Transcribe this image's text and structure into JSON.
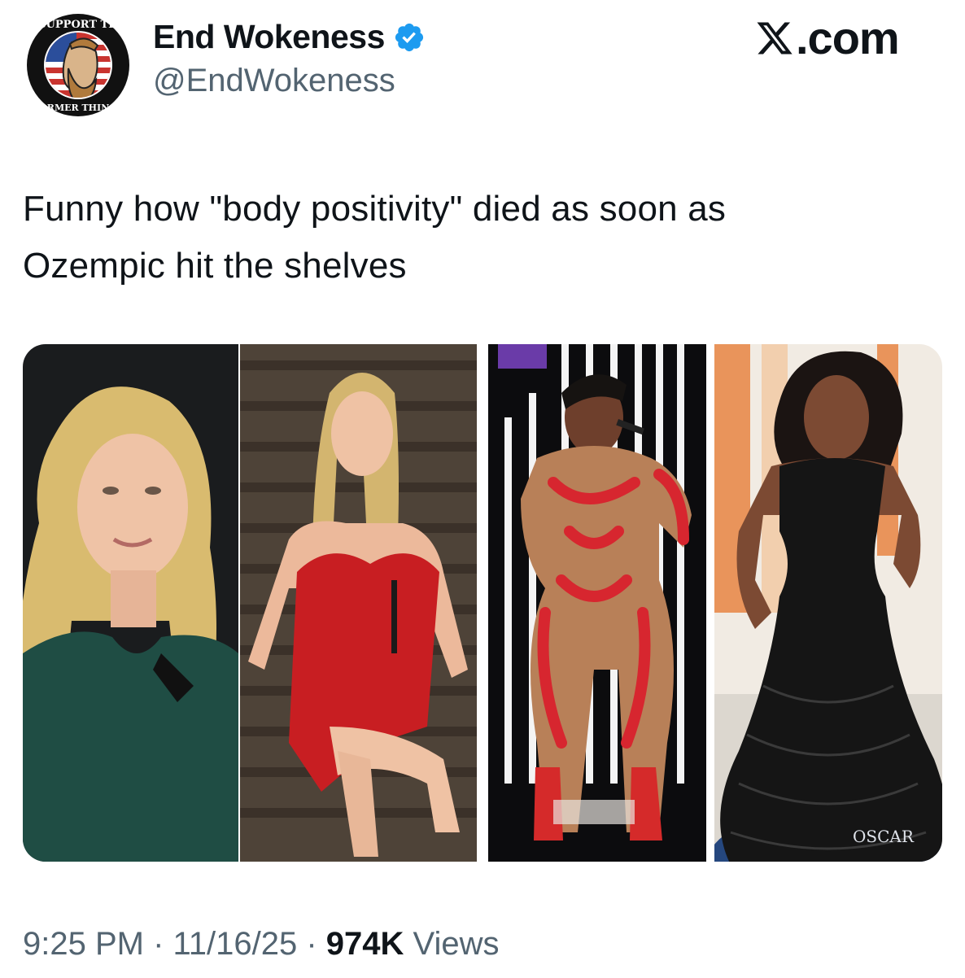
{
  "author": {
    "display_name": "End Wokeness",
    "handle": "@EndWokeness",
    "verified": true,
    "avatar": {
      "icon": "support-former-things-badge",
      "text_top": "I SUPPORT THE",
      "text_bottom": "FORMER THINGS"
    }
  },
  "brand": {
    "label": ".com",
    "icon": "x-logo-icon"
  },
  "tweet": {
    "line1": "Funny how \"body positivity\" died as soon as",
    "line2": "Ozempic hit the shelves"
  },
  "media": {
    "count": 4,
    "photos": [
      {
        "description": "woman-green-dress-portrait"
      },
      {
        "description": "woman-red-dress-on-stairs"
      },
      {
        "description": "performer-red-jumpsuit-on-stage"
      },
      {
        "description": "woman-black-gown-red-carpet",
        "text": "OSCAR"
      }
    ]
  },
  "footer": {
    "time": "9:25 PM",
    "sep1": " · ",
    "date": "11/16/25",
    "sep2": " · ",
    "views_count": "974K",
    "views_label": " Views"
  },
  "colors": {
    "text": "#0f1419",
    "secondary": "#536471",
    "verified_badge": "#1d9bf0"
  }
}
